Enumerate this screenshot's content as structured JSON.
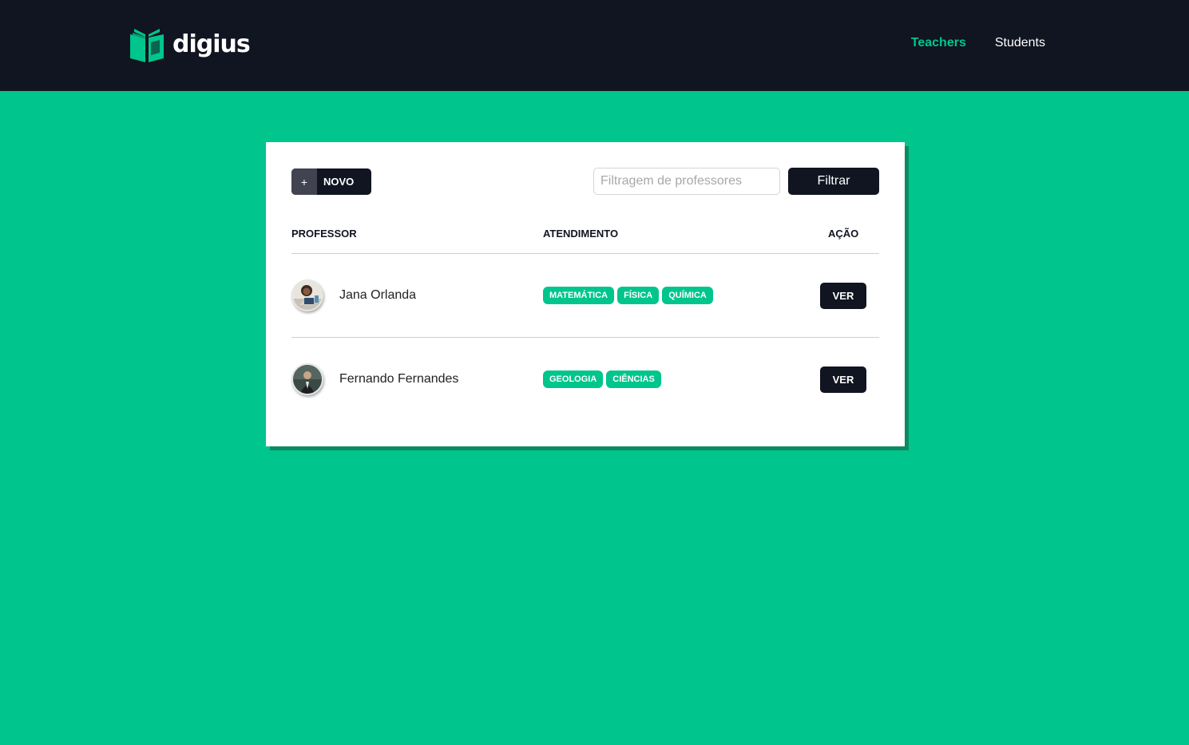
{
  "app": {
    "brand": "digius",
    "accent_color": "#00c58c",
    "dark_color": "#111421"
  },
  "nav": {
    "items": [
      {
        "label": "Teachers",
        "active": true
      },
      {
        "label": "Students",
        "active": false
      }
    ]
  },
  "toolbar": {
    "new_icon": "+",
    "new_label": "NOVO",
    "filter_placeholder": "Filtragem de professores",
    "filter_value": "",
    "filter_button": "Filtrar"
  },
  "table": {
    "columns": [
      "PROFESSOR",
      "ATENDIMENTO",
      "AÇÃO"
    ],
    "rows": [
      {
        "name": "Jana Orlanda",
        "avatar": "woman-with-laptop-photo",
        "tags": [
          "MATEMÁTICA",
          "FÍSICA",
          "QUÍMICA"
        ],
        "action": "VER"
      },
      {
        "name": "Fernando Fernandes",
        "avatar": "man-in-suit-photo",
        "tags": [
          "GEOLOGIA",
          "CIÊNCIAS"
        ],
        "action": "VER"
      }
    ]
  }
}
